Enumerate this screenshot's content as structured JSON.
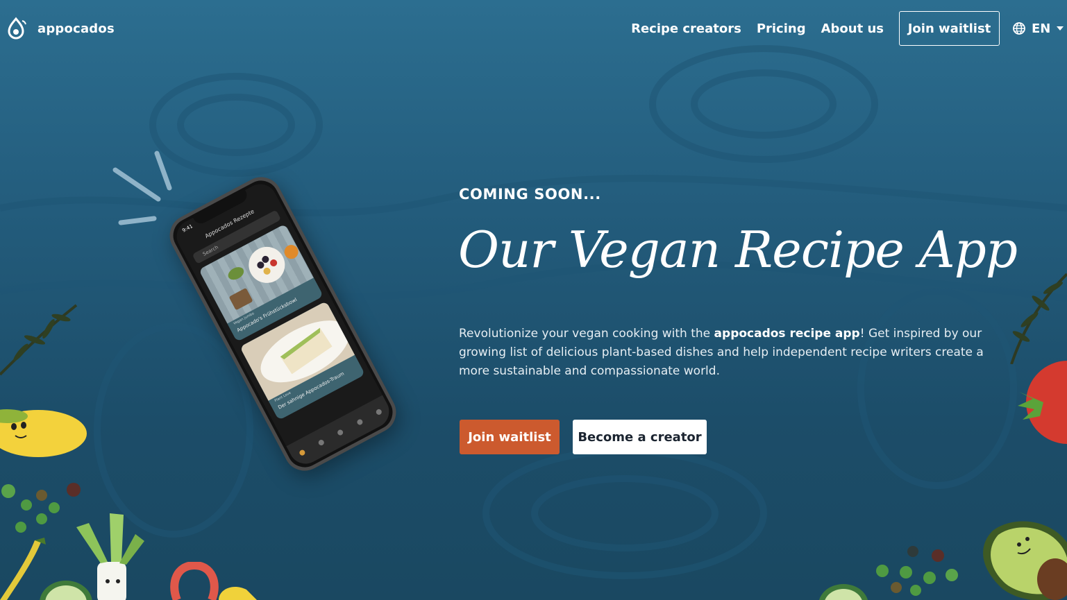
{
  "brand": {
    "name": "appocados"
  },
  "nav": {
    "links": [
      "Recipe creators",
      "Pricing",
      "About us"
    ],
    "waitlist_label": "Join waitlist",
    "language": "EN"
  },
  "hero": {
    "eyebrow": "COMING SOON...",
    "headline": "Our Vegan Recipe App",
    "description_before": "Revolutionize your vegan cooking with the ",
    "description_bold": "appocados recipe app",
    "description_after": "! Get inspired by our growing list of delicious plant-based dishes and help independent recipe writers create a more sustainable and compassionate world.",
    "primary_cta": "Join waitlist",
    "secondary_cta": "Become a creator"
  },
  "phone": {
    "time": "9:41",
    "title": "Appocados Rezepte",
    "search_placeholder": "Search",
    "recipes": [
      {
        "author": "Vegan Jumbo",
        "name": "Appocado's Frühstücksbowl"
      },
      {
        "author": "Plant Love",
        "name": "Der sahnige Appocados-Traum"
      }
    ]
  },
  "colors": {
    "background": "#235c7c",
    "primary_button": "#cc5a2e",
    "secondary_button": "#ffffff"
  }
}
